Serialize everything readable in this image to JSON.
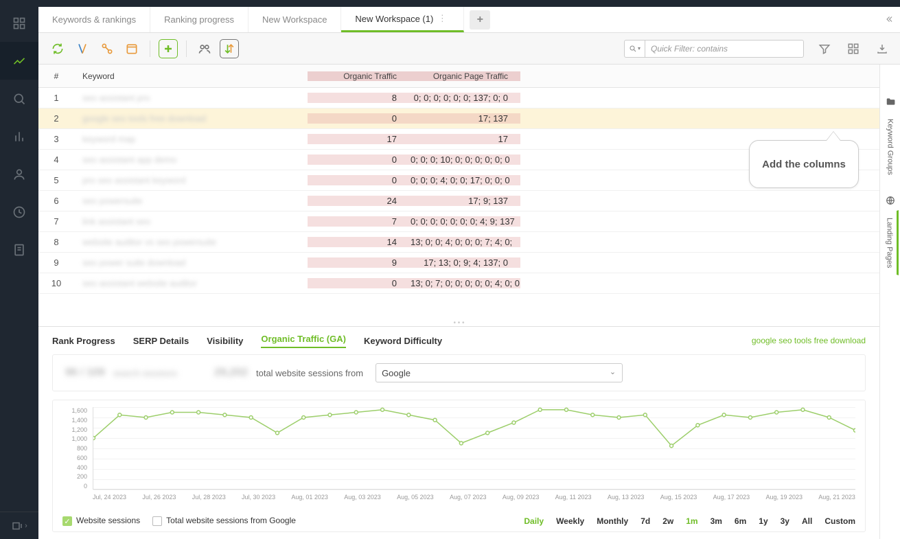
{
  "tabs": [
    {
      "label": "Keywords & rankings",
      "active": false
    },
    {
      "label": "Ranking progress",
      "active": false
    },
    {
      "label": "New Workspace",
      "active": false
    },
    {
      "label": "New Workspace (1)",
      "active": true
    }
  ],
  "toolbar": {
    "search_placeholder": "Quick Filter: contains"
  },
  "tooltip": "Add the columns",
  "table": {
    "headers": {
      "num": "#",
      "keyword": "Keyword",
      "organic_traffic": "Organic Traffic",
      "organic_page_traffic": "Organic Page Traffic"
    },
    "rows": [
      {
        "n": 1,
        "kw": "seo assistant pro",
        "ot": "8",
        "opt": "0; 0; 0; 0; 0; 0; 137; 0; 0"
      },
      {
        "n": 2,
        "kw": "google seo tools free download",
        "ot": "0",
        "opt": "17; 137"
      },
      {
        "n": 3,
        "kw": "keyword map",
        "ot": "17",
        "opt": "17"
      },
      {
        "n": 4,
        "kw": "seo assistant app demo",
        "ot": "0",
        "opt": "0; 0; 0; 10; 0; 0; 0; 0; 0; 0"
      },
      {
        "n": 5,
        "kw": "pro seo assistant keyword",
        "ot": "0",
        "opt": "0; 0; 0; 4; 0; 0; 17; 0; 0; 0"
      },
      {
        "n": 6,
        "kw": "seo powersuite",
        "ot": "24",
        "opt": "17; 9; 137"
      },
      {
        "n": 7,
        "kw": "link assistant seo",
        "ot": "7",
        "opt": "0; 0; 0; 0; 0; 0; 0; 4; 9; 137"
      },
      {
        "n": 8,
        "kw": "website auditor vs seo powersuite",
        "ot": "14",
        "opt": "13; 0; 0; 4; 0; 0; 0; 7; 4; 0;"
      },
      {
        "n": 9,
        "kw": "seo power suite download",
        "ot": "9",
        "opt": "17; 13; 0; 9; 4; 137; 0"
      },
      {
        "n": 10,
        "kw": "seo assistant website auditor",
        "ot": "0",
        "opt": "13; 0; 7; 0; 0; 0; 0; 0; 4; 0; 0"
      }
    ]
  },
  "panel_tabs": [
    {
      "label": "Rank Progress"
    },
    {
      "label": "SERP Details"
    },
    {
      "label": "Visibility"
    },
    {
      "label": "Organic Traffic (GA)",
      "active": true
    },
    {
      "label": "Keyword Difficulty"
    }
  ],
  "panel_link": "google seo tools free download",
  "stats": {
    "value1": "96 / 109",
    "label1": "search sessions",
    "value2": "29,202",
    "label2": "total website sessions from",
    "select_value": "Google"
  },
  "chart_data": {
    "type": "line",
    "title": "",
    "ylabel": "",
    "xlabel": "",
    "ylim": [
      0,
      1600
    ],
    "y_ticks": [
      1600,
      1400,
      1200,
      1000,
      800,
      600,
      400,
      200,
      0
    ],
    "x_ticks": [
      "Jul, 24 2023",
      "Jul, 26 2023",
      "Jul, 28 2023",
      "Jul, 30 2023",
      "Aug, 01 2023",
      "Aug, 03 2023",
      "Aug, 05 2023",
      "Aug, 07 2023",
      "Aug, 09 2023",
      "Aug, 11 2023",
      "Aug, 13 2023",
      "Aug, 15 2023",
      "Aug, 17 2023",
      "Aug, 19 2023",
      "Aug, 21 2023"
    ],
    "series": [
      {
        "name": "Website sessions",
        "color": "#9cce6a",
        "x": [
          0,
          1,
          2,
          3,
          4,
          5,
          6,
          7,
          8,
          9,
          10,
          11,
          12,
          13,
          14,
          15,
          16,
          17,
          18,
          19,
          20,
          21,
          22,
          23,
          24,
          25,
          26,
          27,
          28,
          29
        ],
        "y": [
          1000,
          1450,
          1400,
          1500,
          1500,
          1450,
          1400,
          1100,
          1400,
          1450,
          1500,
          1550,
          1450,
          1350,
          900,
          1100,
          1300,
          1550,
          1550,
          1450,
          1400,
          1450,
          850,
          1250,
          1450,
          1400,
          1500,
          1550,
          1400,
          1150
        ]
      }
    ]
  },
  "legend": {
    "item1": "Website sessions",
    "item2": "Total website sessions from Google"
  },
  "ranges": [
    "Daily",
    "Weekly",
    "Monthly",
    "7d",
    "2w",
    "1m",
    "3m",
    "6m",
    "1y",
    "3y",
    "All",
    "Custom"
  ],
  "range_active": [
    "Daily",
    "1m"
  ],
  "right_tabs": [
    {
      "label": "Keyword Groups",
      "icon": "folder"
    },
    {
      "label": "Landing Pages",
      "icon": "globe",
      "active": true
    }
  ]
}
